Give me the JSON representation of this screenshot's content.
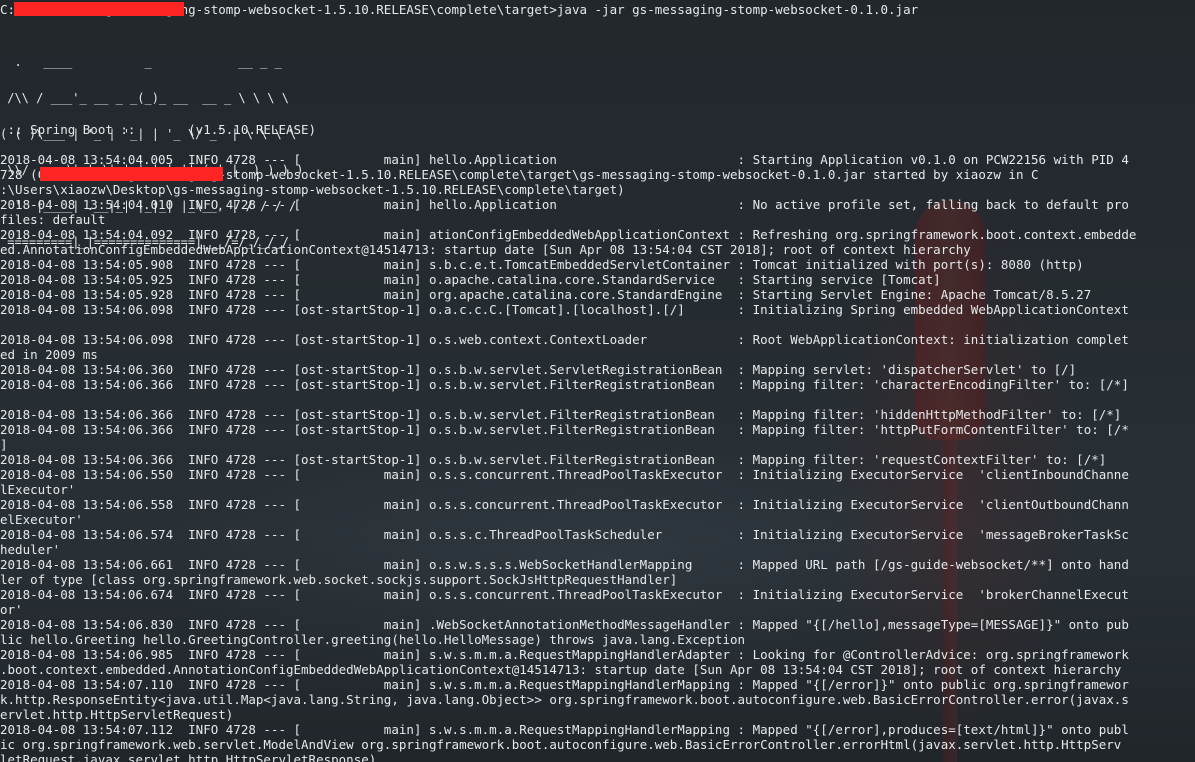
{
  "terminal": {
    "command_line": "C:\\[redacted]\\gs-messaging-stomp-websocket-1.5.10.RELEASE\\complete\\target>java -jar gs-messaging-stomp-websocket-0.1.0.jar",
    "banner": [
      "  .   ____          _            __ _ _",
      " /\\\\ / ___'_ __ _ _(_)_ __  __ _ \\ \\ \\ \\",
      "( ( )\\___ | '_ | '_| | '_ \\/ _` | \\ \\ \\ \\",
      " \\\\/  ___)| |_)| | | | | || (_| |  ) ) ) )",
      "  '  |____| .__|_| |_|_| |_\\__, | / / / /",
      " =========|_|==============|___/=/_/_/_/"
    ],
    "version_line": " :: Spring Boot ::       (v1.5.10.RELEASE)",
    "log_lines": [
      "2018-04-08 13:54:04.005  INFO 4728 --- [           main] hello.Application                        : Starting Application v0.1.0 on PCW22156 with PID 4",
      "728 (C[redacted]\\gs-messaging-stomp-websocket-1.5.10.RELEASE\\complete\\target\\gs-messaging-stomp-websocket-0.1.0.jar started by xiaozw in C",
      ":\\Users\\xiaozw\\Desktop\\gs-messaging-stomp-websocket-1.5.10.RELEASE\\complete\\target)",
      "2018-04-08 13:54:04.010  INFO 4728 --- [           main] hello.Application                        : No active profile set, falling back to default pro",
      "files: default",
      "2018-04-08 13:54:04.092  INFO 4728 --- [           main] ationConfigEmbeddedWebApplicationContext : Refreshing org.springframework.boot.context.embedde",
      "ed.AnnotationConfigEmbeddedWebApplicationContext@14514713: startup date [Sun Apr 08 13:54:04 CST 2018]; root of context hierarchy",
      "2018-04-08 13:54:05.908  INFO 4728 --- [           main] s.b.c.e.t.TomcatEmbeddedServletContainer : Tomcat initialized with port(s): 8080 (http)",
      "2018-04-08 13:54:05.925  INFO 4728 --- [           main] o.apache.catalina.core.StandardService   : Starting service [Tomcat]",
      "2018-04-08 13:54:05.928  INFO 4728 --- [           main] org.apache.catalina.core.StandardEngine  : Starting Servlet Engine: Apache Tomcat/8.5.27",
      "2018-04-08 13:54:06.098  INFO 4728 --- [ost-startStop-1] o.a.c.c.C.[Tomcat].[localhost].[/]       : Initializing Spring embedded WebApplicationContext",
      "",
      "2018-04-08 13:54:06.098  INFO 4728 --- [ost-startStop-1] o.s.web.context.ContextLoader            : Root WebApplicationContext: initialization complet",
      "ed in 2009 ms",
      "2018-04-08 13:54:06.360  INFO 4728 --- [ost-startStop-1] o.s.b.w.servlet.ServletRegistrationBean  : Mapping servlet: 'dispatcherServlet' to [/]",
      "2018-04-08 13:54:06.366  INFO 4728 --- [ost-startStop-1] o.s.b.w.servlet.FilterRegistrationBean   : Mapping filter: 'characterEncodingFilter' to: [/*]",
      "",
      "2018-04-08 13:54:06.366  INFO 4728 --- [ost-startStop-1] o.s.b.w.servlet.FilterRegistrationBean   : Mapping filter: 'hiddenHttpMethodFilter' to: [/*]",
      "2018-04-08 13:54:06.366  INFO 4728 --- [ost-startStop-1] o.s.b.w.servlet.FilterRegistrationBean   : Mapping filter: 'httpPutFormContentFilter' to: [/*",
      "]",
      "2018-04-08 13:54:06.366  INFO 4728 --- [ost-startStop-1] o.s.b.w.servlet.FilterRegistrationBean   : Mapping filter: 'requestContextFilter' to: [/*]",
      "2018-04-08 13:54:06.550  INFO 4728 --- [           main] o.s.s.concurrent.ThreadPoolTaskExecutor  : Initializing ExecutorService  'clientInboundChanne",
      "lExecutor'",
      "2018-04-08 13:54:06.558  INFO 4728 --- [           main] o.s.s.concurrent.ThreadPoolTaskExecutor  : Initializing ExecutorService  'clientOutboundChann",
      "elExecutor'",
      "2018-04-08 13:54:06.574  INFO 4728 --- [           main] o.s.s.c.ThreadPoolTaskScheduler          : Initializing ExecutorService  'messageBrokerTaskSc",
      "heduler'",
      "2018-04-08 13:54:06.661  INFO 4728 --- [           main] o.s.w.s.s.s.WebSocketHandlerMapping      : Mapped URL path [/gs-guide-websocket/**] onto hand",
      "ler of type [class org.springframework.web.socket.sockjs.support.SockJsHttpRequestHandler]",
      "2018-04-08 13:54:06.674  INFO 4728 --- [           main] o.s.s.concurrent.ThreadPoolTaskExecutor  : Initializing ExecutorService  'brokerChannelExecut",
      "or'",
      "2018-04-08 13:54:06.830  INFO 4728 --- [           main] .WebSocketAnnotationMethodMessageHandler : Mapped \"{[/hello],messageType=[MESSAGE]}\" onto pub",
      "lic hello.Greeting hello.GreetingController.greeting(hello.HelloMessage) throws java.lang.Exception",
      "2018-04-08 13:54:06.985  INFO 4728 --- [           main] s.w.s.m.m.a.RequestMappingHandlerAdapter : Looking for @ControllerAdvice: org.springframework",
      ".boot.context.embedded.AnnotationConfigEmbeddedWebApplicationContext@14514713: startup date [Sun Apr 08 13:54:04 CST 2018]; root of context hierarchy",
      "2018-04-08 13:54:07.110  INFO 4728 --- [           main] s.w.s.m.m.a.RequestMappingHandlerMapping : Mapped \"{[/error]}\" onto public org.springframewor",
      "k.http.ResponseEntity<java.util.Map<java.lang.String, java.lang.Object>> org.springframework.boot.autoconfigure.web.BasicErrorController.error(javax.s",
      "ervlet.http.HttpServletRequest)",
      "2018-04-08 13:54:07.112  INFO 4728 --- [           main] s.w.s.m.m.a.RequestMappingHandlerMapping : Mapped \"{[/error],produces=[text/html]}\" onto publ",
      "ic org.springframework.web.servlet.ModelAndView org.springframework.boot.autoconfigure.web.BasicErrorController.errorHtml(javax.servlet.http.HttpServ",
      "letRequest,javax.servlet.http.HttpServletResponse)"
    ]
  },
  "colors": {
    "text": "#e6e8ea",
    "redaction": "#ff2525",
    "background": "#2b3237"
  }
}
